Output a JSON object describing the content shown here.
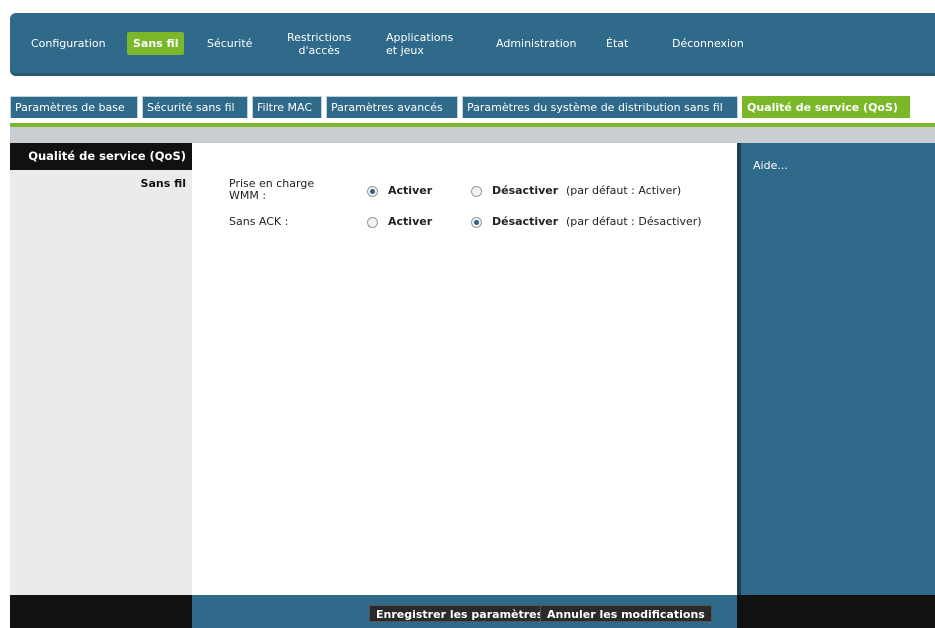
{
  "topnav": {
    "items": [
      {
        "label": "Configuration"
      },
      {
        "label": "Sans fil",
        "active": true
      },
      {
        "label": "Sécurité"
      },
      {
        "label": "Restrictions d'accès",
        "line1": "Restrictions",
        "line2": "d'accès"
      },
      {
        "label": "Applications et jeux",
        "line1": "Applications",
        "line2": "et jeux"
      },
      {
        "label": "Administration"
      },
      {
        "label": "État"
      },
      {
        "label": "Déconnexion"
      }
    ]
  },
  "subtabs": [
    {
      "label": "Paramètres de base"
    },
    {
      "label": "Sécurité sans fil"
    },
    {
      "label": "Filtre MAC"
    },
    {
      "label": "Paramètres avancés"
    },
    {
      "label": "Paramètres du système de distribution sans fil"
    },
    {
      "label": "Qualité de service (QoS)",
      "active": true
    }
  ],
  "sidebar": {
    "title": "Qualité de service (QoS)",
    "subtitle": "Sans fil"
  },
  "settings": {
    "wmm": {
      "label_line1": "Prise en charge",
      "label_line2": "WMM :",
      "enable_label": "Activer",
      "disable_label": "Désactiver",
      "default_note": "(par défaut : Activer)",
      "selected": "Activer"
    },
    "noack": {
      "label": "Sans ACK :",
      "enable_label": "Activer",
      "disable_label": "Désactiver",
      "default_note": "(par défaut : Désactiver)",
      "selected": "Désactiver"
    }
  },
  "help": {
    "label": "Aide..."
  },
  "footer": {
    "save_label": "Enregistrer les paramètres",
    "cancel_label": "Annuler les modifications"
  },
  "colors": {
    "primary_blue": "#2f6a8a",
    "accent_green": "#7ab82a",
    "dark": "#111111"
  }
}
